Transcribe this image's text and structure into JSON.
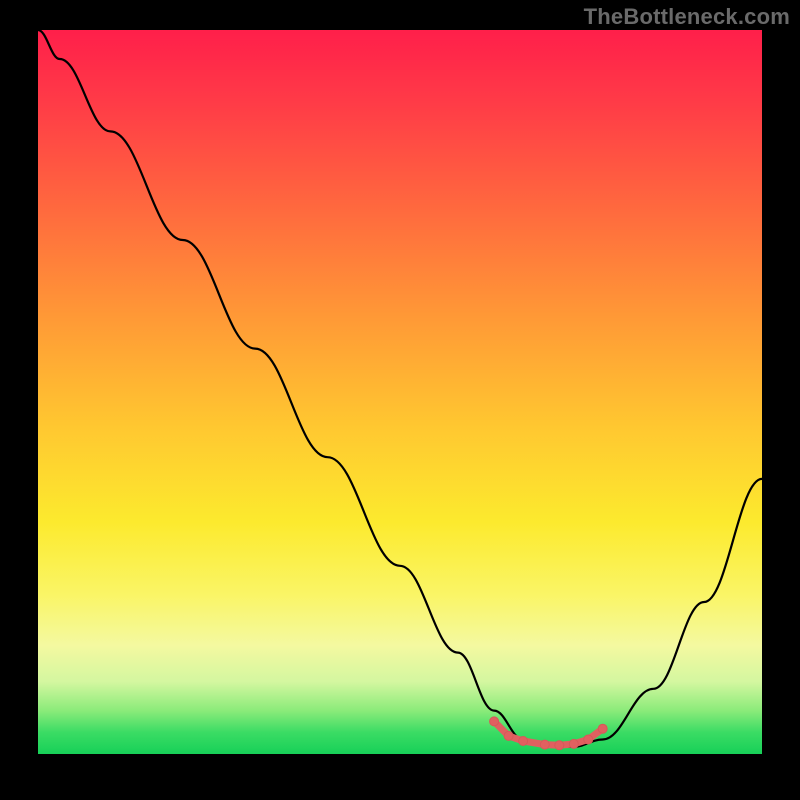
{
  "watermark": "TheBottleneck.com",
  "colors": {
    "curve": "#000000",
    "highlight": "#e06060",
    "background": "#000000"
  },
  "chart_data": {
    "type": "line",
    "title": "",
    "xlabel": "",
    "ylabel": "",
    "xlim": [
      0,
      100
    ],
    "ylim": [
      0,
      100
    ],
    "grid": false,
    "series": [
      {
        "name": "bottleneck-curve",
        "x": [
          0,
          3,
          10,
          20,
          30,
          40,
          50,
          58,
          63,
          67,
          70,
          74,
          78,
          85,
          92,
          100
        ],
        "y": [
          100,
          96,
          86,
          71,
          56,
          41,
          26,
          14,
          6,
          2,
          1,
          1,
          2,
          9,
          21,
          38
        ]
      }
    ],
    "highlight_region": {
      "name": "valley-floor",
      "x": [
        63,
        65,
        67,
        70,
        72,
        74,
        76,
        78
      ],
      "y": [
        4.5,
        2.5,
        1.8,
        1.3,
        1.2,
        1.4,
        2.0,
        3.5
      ]
    }
  }
}
